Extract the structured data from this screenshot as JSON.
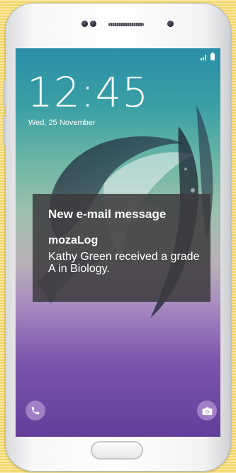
{
  "lockscreen": {
    "time": "12:45",
    "date": "Wed, 25 November"
  },
  "status_bar": {
    "icons": [
      "signal-icon",
      "battery-icon"
    ]
  },
  "notification": {
    "title": "New e-mail message",
    "app": "mozaLog",
    "body": "Kathy Green received a grade A in Biology."
  },
  "shortcuts": {
    "left_icon": "phone-icon",
    "right_icon": "camera-icon"
  },
  "colors": {
    "background": "#f7df7c",
    "notification_bg": "#3c3a3e",
    "screen_top": "#2a8ea8",
    "screen_bottom": "#613e9a"
  }
}
